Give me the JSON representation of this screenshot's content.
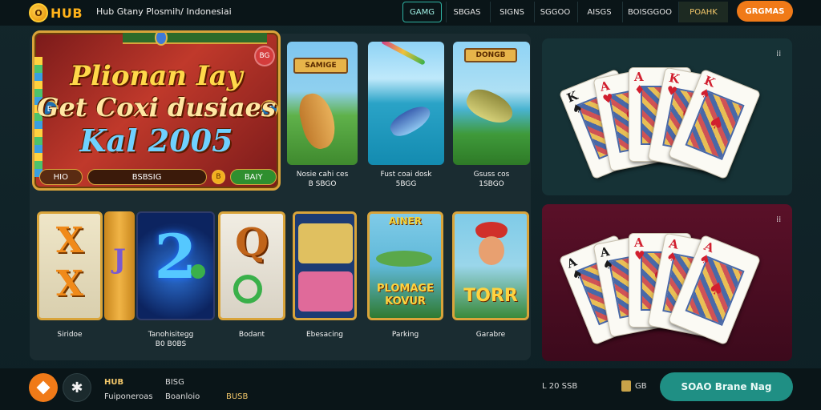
{
  "header": {
    "logo_text": "HUB",
    "site_title": "Hub Gtany Plosmih/ Indonesiai",
    "nav": [
      "GAMG",
      "SBGAS",
      "SIGNS",
      "SGGOO",
      "AISGS",
      "BOISGGOO",
      "POAHK"
    ],
    "cta_label": "GRGMAS"
  },
  "hero": {
    "line1": "Plionan Iay",
    "line2": "Get Coxi dusiaes",
    "line3": "Kal 2005",
    "badge_right": "BG",
    "side_left": "B",
    "side_right": "B",
    "bar_left": "HIO",
    "bar_mid": "BSBSIG",
    "bar_coin": "B",
    "bar_right": "BAIY"
  },
  "row1_tiles": [
    {
      "sign": "SAMIGE",
      "caption_1": "Nosie cahi ces",
      "caption_2": "B SBGO"
    },
    {
      "sign": "",
      "caption_1": "Fust coai dosk",
      "caption_2": "5BGG"
    },
    {
      "sign": "DONGB",
      "caption_1": "Gsuss cos",
      "caption_2": "1SBGO"
    }
  ],
  "row2_tiles": [
    {
      "glyph_top": "X",
      "glyph_bottom": "X",
      "caption_1": "Siridoe",
      "caption_2": ""
    },
    {
      "glyph_top": "J",
      "glyph_bottom": "",
      "caption_1": "",
      "caption_2": ""
    },
    {
      "glyph_top": "2",
      "glyph_bottom": "",
      "caption_1": "Tanohisitegg",
      "caption_2": "B0 B0BS"
    },
    {
      "glyph_top": "Q",
      "glyph_bottom": "",
      "caption_1": "Bodant",
      "caption_2": ""
    },
    {
      "glyph_top": "",
      "glyph_bottom": "",
      "caption_1": "Ebesacing",
      "caption_2": ""
    },
    {
      "glyph_top": "AINER",
      "glyph_bottom": "PLOMAGE\nKOVUR",
      "caption_1": "Parking",
      "caption_2": ""
    },
    {
      "glyph_top": "",
      "glyph_bottom": "TORR",
      "caption_1": "Garabre",
      "caption_2": ""
    }
  ],
  "cards_top": [
    {
      "rank": "K",
      "suit": "♠",
      "color": "black"
    },
    {
      "rank": "A",
      "suit": "♥",
      "color": "red"
    },
    {
      "rank": "A",
      "suit": "♦",
      "color": "red"
    },
    {
      "rank": "K",
      "suit": "♥",
      "color": "red"
    },
    {
      "rank": "K",
      "suit": "♠",
      "color": "red"
    }
  ],
  "cards_bottom": [
    {
      "rank": "A",
      "suit": "♠",
      "color": "black"
    },
    {
      "rank": "A",
      "suit": "♠",
      "color": "black"
    },
    {
      "rank": "A",
      "suit": "♥",
      "color": "red"
    },
    {
      "rank": "A",
      "suit": "♠",
      "color": "red"
    },
    {
      "rank": "A",
      "suit": "♠",
      "color": "red"
    }
  ],
  "card_panel_icon": "⁞⁞",
  "footer": {
    "brand": "HUB",
    "brand_sub": "Fuiponeroas",
    "col2_title": "BISG",
    "col2_sub": "Boanloio",
    "col2_link": "BUSB",
    "stat1": "L  20 SSB",
    "stat2": "GB",
    "cta_label": "SOAO Brane Nag"
  },
  "colors": {
    "accent_orange": "#f07a18",
    "accent_teal": "#1f8f84",
    "gold": "#d9a43a",
    "background": "#13262b"
  }
}
